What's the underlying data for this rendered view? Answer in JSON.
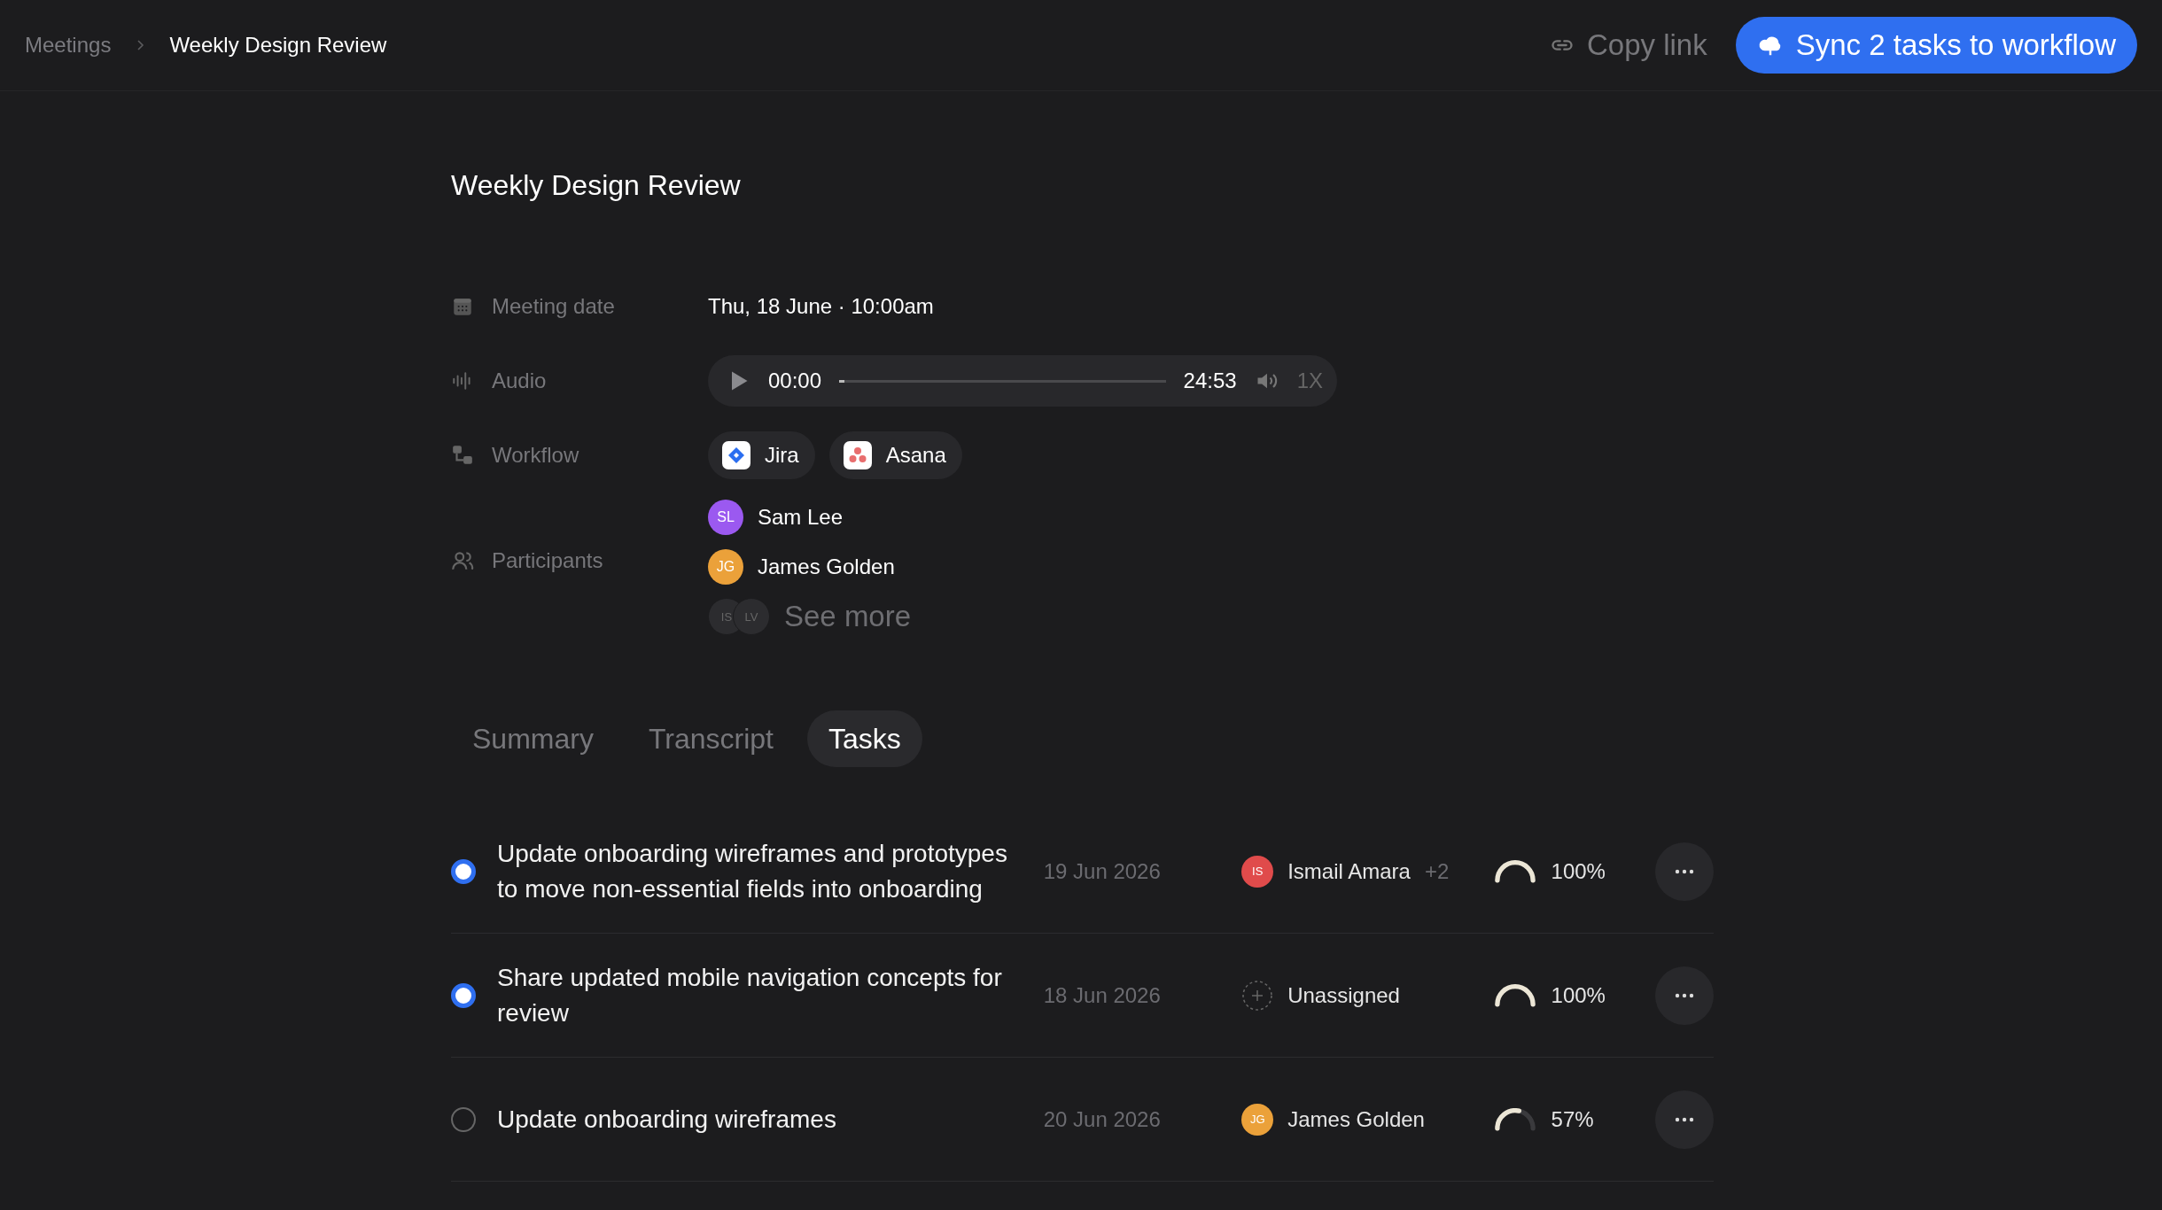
{
  "breadcrumb": [
    {
      "label": "Meetings",
      "current": false
    },
    {
      "label": "Weekly Design Review",
      "current": true
    }
  ],
  "copy_link": "Copy link",
  "sync_button": "Sync 2 tasks to workflow",
  "title": "Weekly Design Review",
  "meeting_date": {
    "label": "Meeting date",
    "value": "Thu, 18 June · 10:00am"
  },
  "audio": {
    "label": "Audio",
    "current": "00:00",
    "level": 0.01,
    "duration": "24:53",
    "speed": "1X"
  },
  "workflow": {
    "label": "Workflow",
    "apps": [
      {
        "name": "Jira",
        "kind": "jira"
      },
      {
        "name": "Asana",
        "kind": "asana"
      }
    ]
  },
  "participants": {
    "label": "Participants",
    "people": [
      {
        "initials": "SL",
        "name": "Sam Lee",
        "color": "#9b59f0"
      },
      {
        "initials": "JG",
        "name": "James Golden",
        "color": "#eba13a"
      }
    ],
    "more_avatars": [
      {
        "initials": "IS"
      },
      {
        "initials": "LV"
      }
    ],
    "see_more": "See more"
  },
  "tabs": [
    {
      "label": "Summary",
      "selected": false
    },
    {
      "label": "Transcript",
      "selected": false
    },
    {
      "label": "Tasks",
      "selected": true
    }
  ],
  "tasks": [
    {
      "text": "Update onboarding wireframes and prototypes to move non-essential fields into onboarding",
      "checked": true,
      "date": "19 Jun 2026",
      "assignee": {
        "kind": "person",
        "initials": "IS",
        "name": "Ismail Amara",
        "color": "#e04b4b",
        "extra": "+2"
      },
      "level": 1,
      "percent": "100%"
    },
    {
      "text": "Share updated mobile navigation concepts for review",
      "checked": true,
      "date": "18 Jun 2026",
      "assignee": {
        "kind": "unassigned",
        "name": "Unassigned"
      },
      "level": 1,
      "percent": "100%"
    },
    {
      "text": "Update onboarding wireframes",
      "checked": false,
      "date": "20 Jun 2026",
      "assignee": {
        "kind": "person",
        "initials": "JG",
        "name": "James Golden",
        "color": "#eba13a"
      },
      "level": 0.57,
      "percent": "57%"
    }
  ]
}
